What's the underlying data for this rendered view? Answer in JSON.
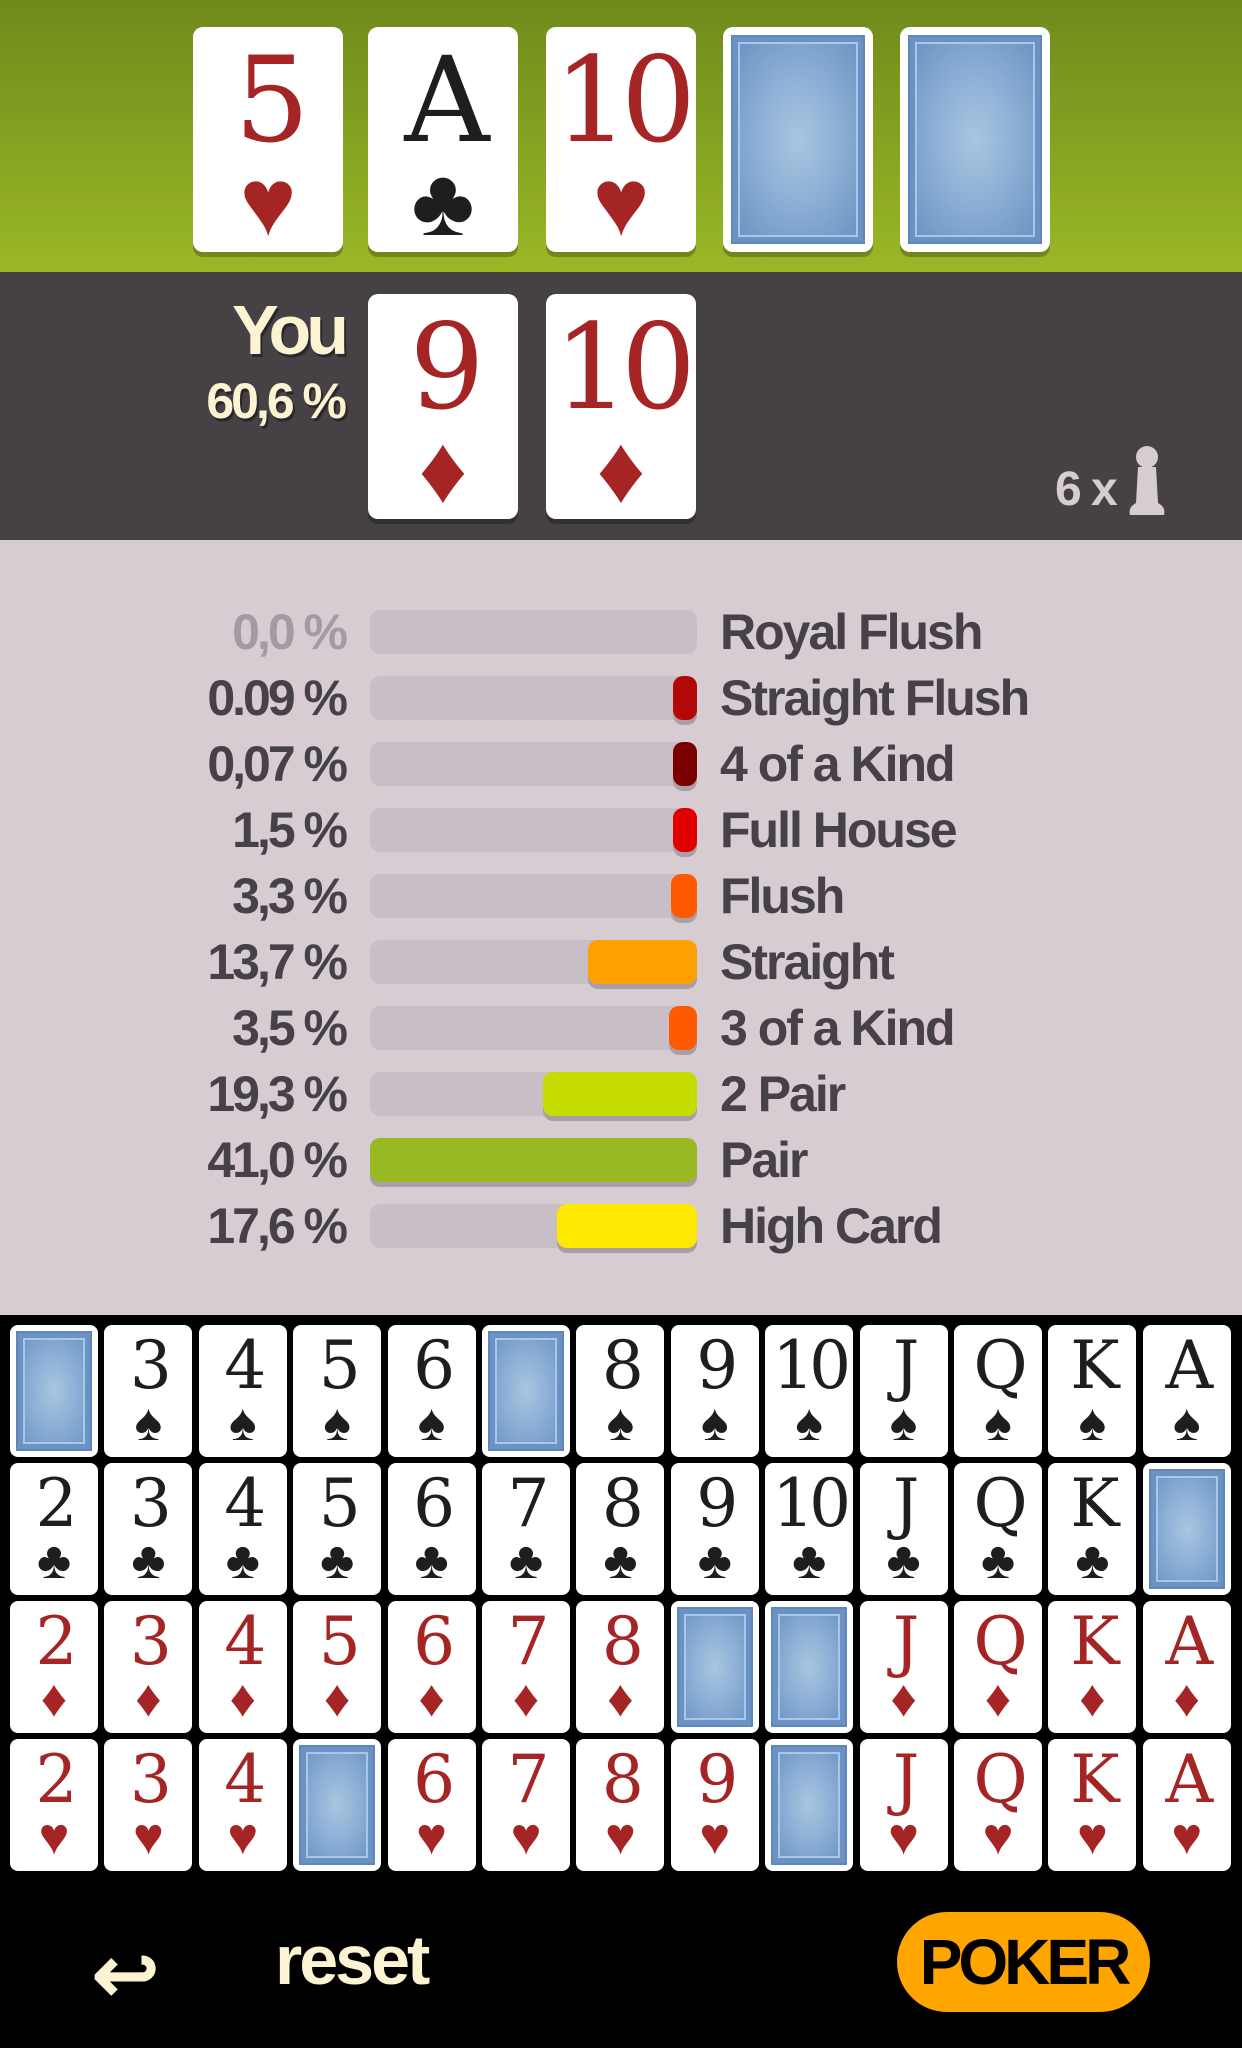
{
  "board": {
    "cards": [
      {
        "rank": "5",
        "suit": "♥",
        "color": "red",
        "face_down": false
      },
      {
        "rank": "A",
        "suit": "♣",
        "color": "black",
        "face_down": false
      },
      {
        "rank": "10",
        "suit": "♥",
        "color": "red",
        "face_down": false
      },
      {
        "face_down": true
      },
      {
        "face_down": true
      }
    ]
  },
  "player": {
    "name": "You",
    "win_chance": "60,6 %",
    "cards": [
      {
        "rank": "9",
        "suit": "♦",
        "color": "red"
      },
      {
        "rank": "10",
        "suit": "♦",
        "color": "red"
      }
    ],
    "player_count": "6 x",
    "player_icon": "pawn-icon"
  },
  "hands": [
    {
      "label": "Royal Flush",
      "percent": "0,0 %",
      "value": 0.0,
      "color": "#c8bfc6",
      "dim": true
    },
    {
      "label": "Straight Flush",
      "percent": "0.09 %",
      "value": 0.09,
      "color": "#b30808"
    },
    {
      "label": "4 of a Kind",
      "percent": "0,07 %",
      "value": 0.07,
      "color": "#7a0000"
    },
    {
      "label": "Full House",
      "percent": "1,5 %",
      "value": 1.5,
      "color": "#e00000"
    },
    {
      "label": "Flush",
      "percent": "3,3 %",
      "value": 3.3,
      "color": "#ff5a00"
    },
    {
      "label": "Straight",
      "percent": "13,7 %",
      "value": 13.7,
      "color": "#ffa000"
    },
    {
      "label": "3 of a Kind",
      "percent": "3,5 %",
      "value": 3.5,
      "color": "#ff5a00"
    },
    {
      "label": "2 Pair",
      "percent": "19,3 %",
      "value": 19.3,
      "color": "#c4dc00"
    },
    {
      "label": "Pair",
      "percent": "41,0 %",
      "value": 41.0,
      "color": "#98b824"
    },
    {
      "label": "High Card",
      "percent": "17,6 %",
      "value": 17.6,
      "color": "#ffe800"
    }
  ],
  "deck": {
    "ranks": [
      "2",
      "3",
      "4",
      "5",
      "6",
      "7",
      "8",
      "9",
      "10",
      "J",
      "Q",
      "K",
      "A"
    ],
    "suits": [
      {
        "symbol": "♠",
        "color": "black",
        "face_down_ranks": [
          "2",
          "7"
        ]
      },
      {
        "symbol": "♣",
        "color": "black",
        "face_down_ranks": [
          "A"
        ]
      },
      {
        "symbol": "♦",
        "color": "red",
        "face_down_ranks": [
          "9",
          "10"
        ]
      },
      {
        "symbol": "♥",
        "color": "red",
        "face_down_ranks": [
          "5",
          "10"
        ]
      }
    ]
  },
  "footer": {
    "reset_icon": "return-arrow-icon",
    "reset_label": "reset",
    "poker_label": "POKER"
  },
  "colors": {
    "accent": "#ffa500",
    "red_suit": "#a52424",
    "card_back": "#8cafd5"
  }
}
